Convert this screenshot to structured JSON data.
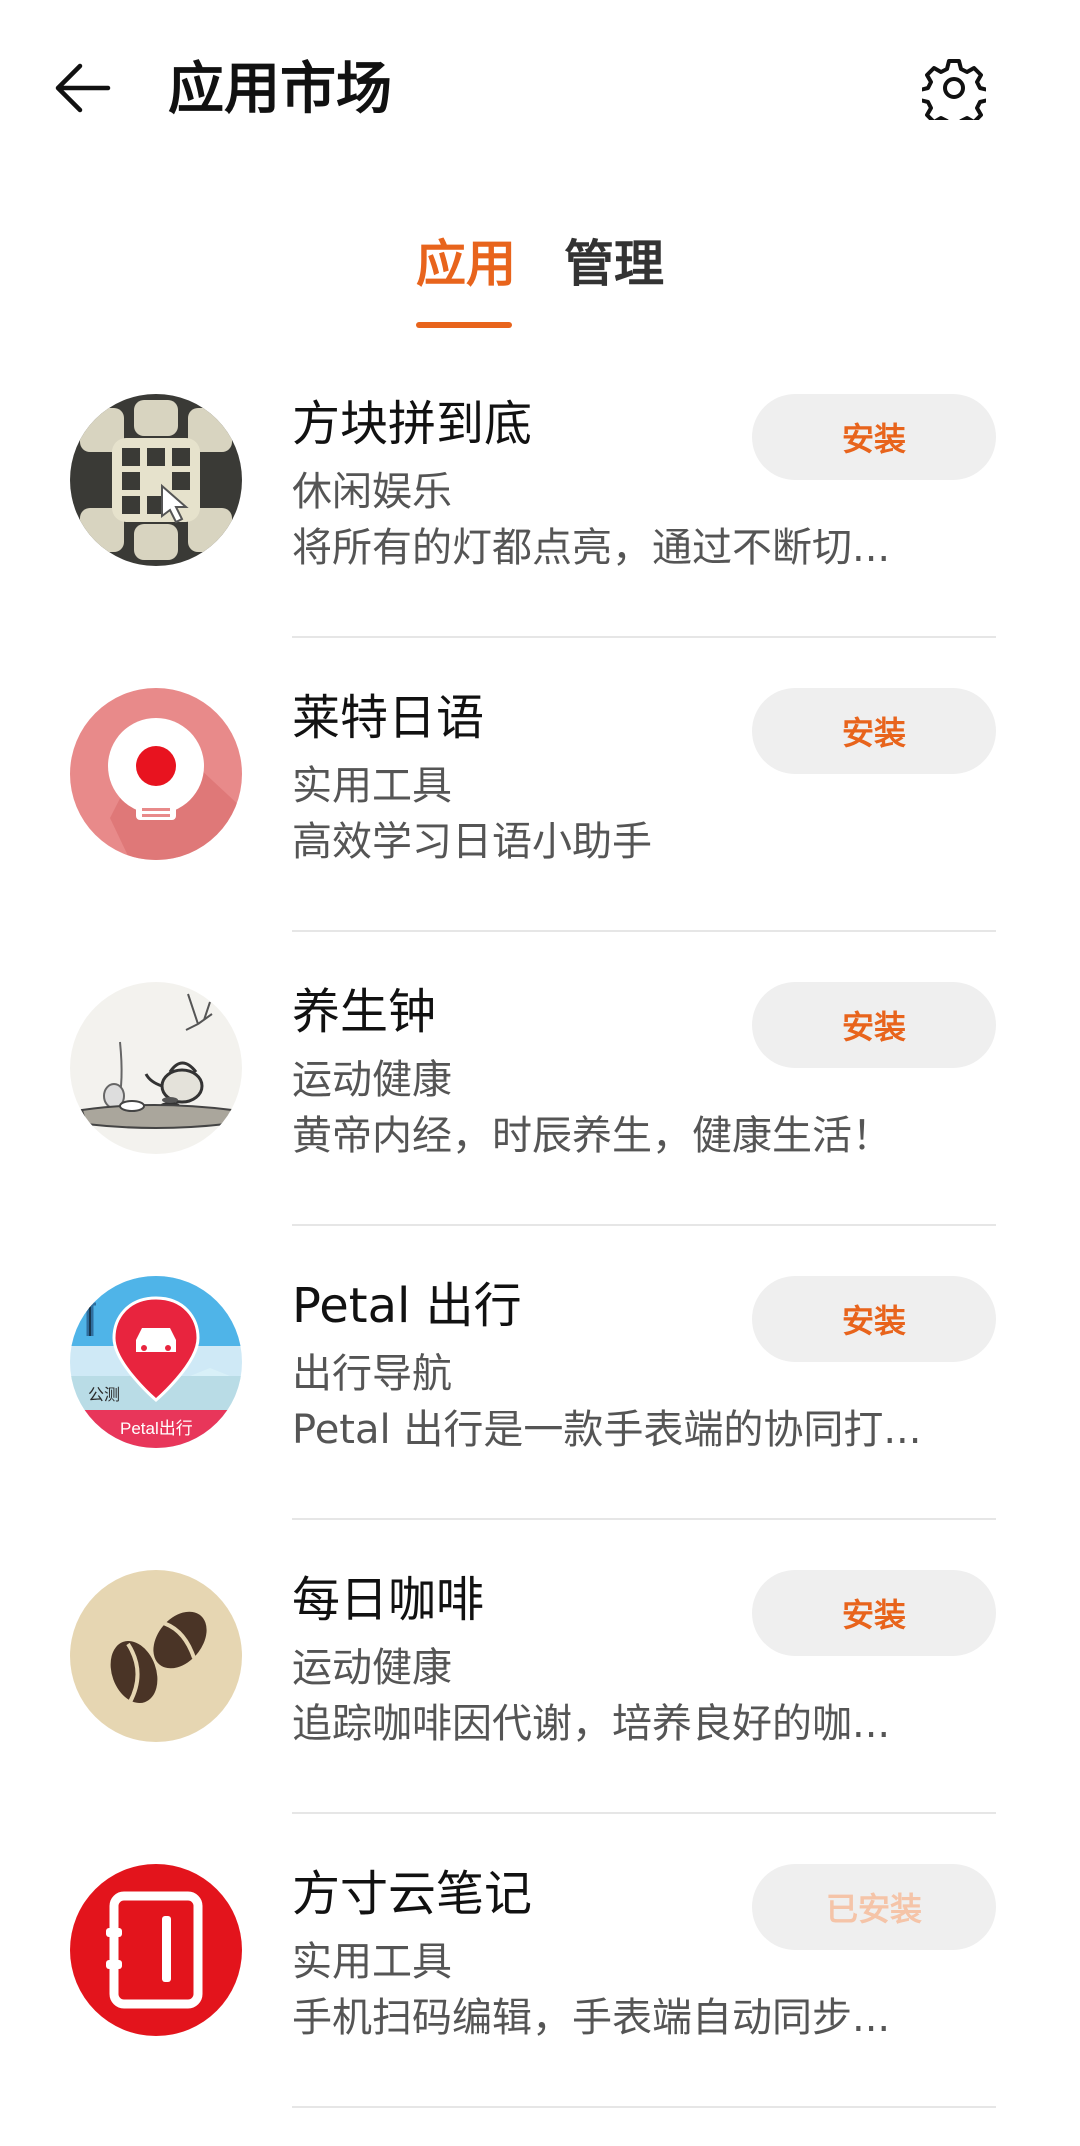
{
  "header": {
    "back_icon": "arrow-left-icon",
    "title": "应用市场",
    "settings_icon": "gear-icon"
  },
  "tabs": [
    {
      "label": "应用",
      "active": true
    },
    {
      "label": "管理",
      "active": false
    }
  ],
  "colors": {
    "accent": "#e8641c",
    "button_bg": "#efefef",
    "installed_text": "#f5c4a8",
    "secondary_text": "#555555",
    "divider": "#e6e6e6"
  },
  "apps": [
    {
      "name": "方块拼到底",
      "category": "休闲娱乐",
      "description": "将所有的灯都点亮，通过不断切...",
      "button": "安装",
      "installed": false,
      "icon": "puzzle-blocks-icon"
    },
    {
      "name": "莱特日语",
      "category": "实用工具",
      "description": "高效学习日语小助手",
      "button": "安装",
      "installed": false,
      "icon": "lightbulb-icon"
    },
    {
      "name": "养生钟",
      "category": "运动健康",
      "description": "黄帝内经，时辰养生，健康生活！",
      "button": "安装",
      "installed": false,
      "icon": "teapot-ink-icon"
    },
    {
      "name": "Petal 出行",
      "category": "出行导航",
      "description": "Petal 出行是一款手表端的协同打...",
      "button": "安装",
      "installed": false,
      "icon": "car-location-pin-icon",
      "icon_badge": "公测",
      "icon_caption": "Petal出行"
    },
    {
      "name": "每日咖啡",
      "category": "运动健康",
      "description": "追踪咖啡因代谢，培养良好的咖...",
      "button": "安装",
      "installed": false,
      "icon": "coffee-beans-icon"
    },
    {
      "name": "方寸云笔记",
      "category": "实用工具",
      "description": "手机扫码编辑，手表端自动同步...",
      "button": "已安装",
      "installed": true,
      "icon": "notebook-icon"
    }
  ]
}
